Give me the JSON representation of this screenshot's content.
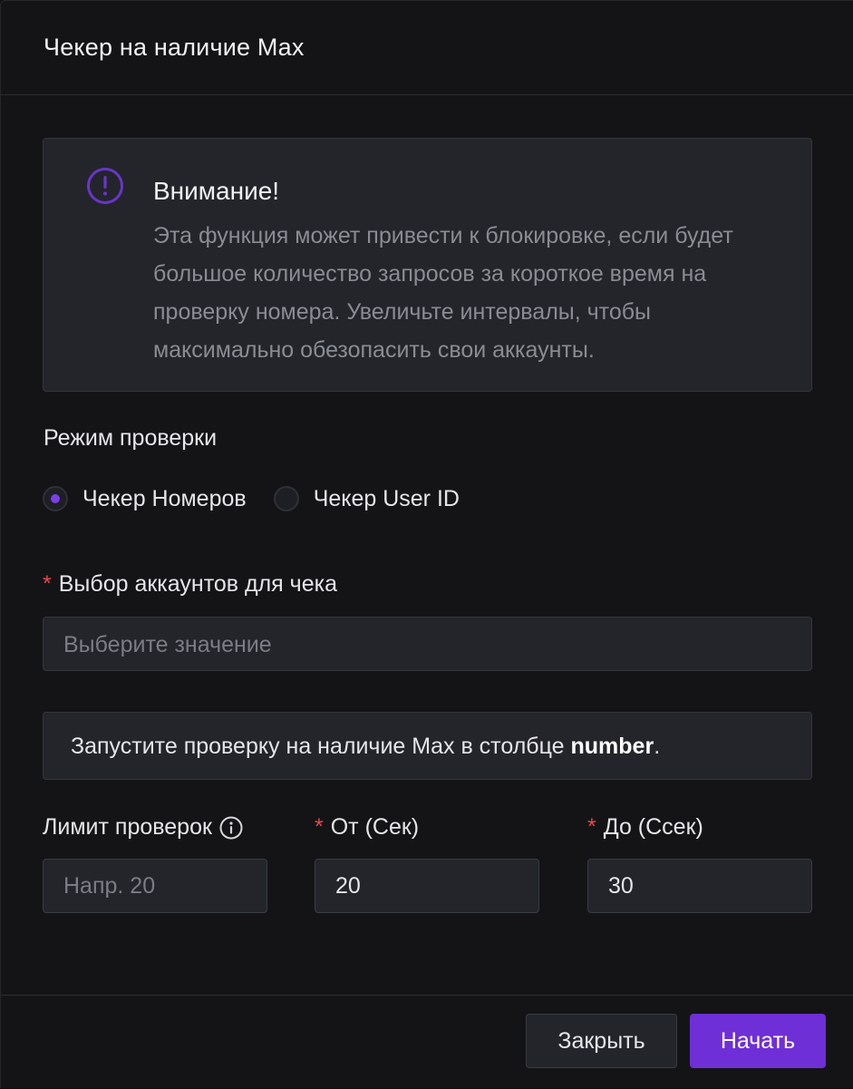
{
  "modal": {
    "title": "Чекер на наличие Max"
  },
  "alert": {
    "icon": "exclamation-circle-icon",
    "title": "Внимание!",
    "text": "Эта функция может привести к блокировке, если будет большое количество запросов за короткое время на проверку номера. Увеличьте интервалы, чтобы максимально обезопасить свои аккаунты."
  },
  "mode": {
    "label": "Режим проверки",
    "options": [
      {
        "label": "Чекер Номеров",
        "checked": true
      },
      {
        "label": "Чекер User ID",
        "checked": false
      }
    ]
  },
  "accounts": {
    "required_mark": "*",
    "label": "Выбор аккаунтов для чека",
    "placeholder": "Выберите значение"
  },
  "info": {
    "text_before": "Запустите проверку на наличие Max в столбце ",
    "bold": "number",
    "text_after": "."
  },
  "limits": {
    "limit_label": "Лимит проверок",
    "limit_icon": "info-icon",
    "limit_placeholder": "Напр. 20",
    "from_required": "*",
    "from_label": "От (Сек)",
    "from_value": "20",
    "to_required": "*",
    "to_label": "До (Ссек)",
    "to_value": "30"
  },
  "footer": {
    "close_label": "Закрыть",
    "start_label": "Начать"
  },
  "colors": {
    "accent": "#6f2fd6",
    "warning_icon": "#6a35c9",
    "required": "#e5484d",
    "background": "#141417",
    "panel": "#23252b"
  }
}
